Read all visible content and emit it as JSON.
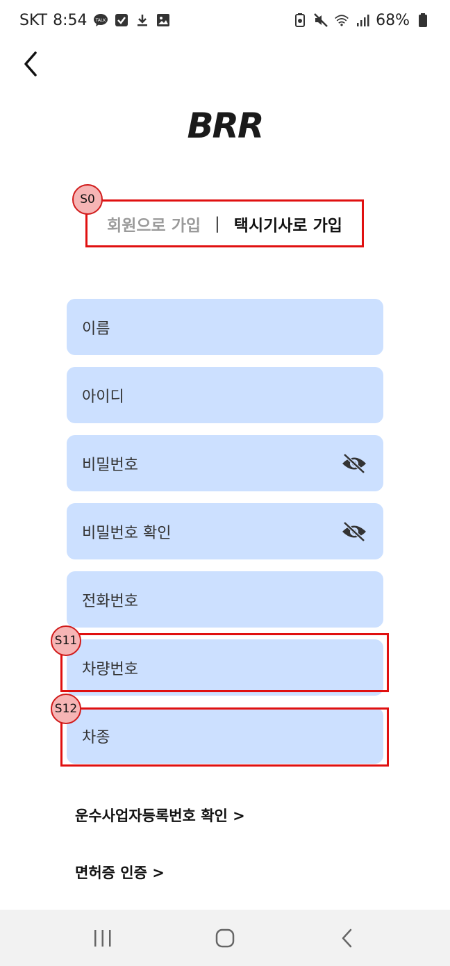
{
  "status_bar": {
    "carrier": "SKT",
    "time": "8:54",
    "battery": "68%",
    "left_icons": [
      "talk-icon",
      "checkbox-icon",
      "download-icon",
      "image-icon"
    ],
    "right_icons": [
      "battery-saver-icon",
      "mute-icon",
      "wifi-icon",
      "signal-icon",
      "battery-icon"
    ]
  },
  "header": {
    "logo": "BRR"
  },
  "tabs": {
    "member": "회원으로 가입",
    "separator": "|",
    "driver": "택시기사로 가입",
    "active": "driver"
  },
  "form": {
    "name": "이름",
    "id": "아이디",
    "password": "비밀번호",
    "password_confirm": "비밀번호 확인",
    "phone": "전화번호",
    "car_number": "차량번호",
    "car_model": "차종"
  },
  "links": {
    "business_registration": "운수사업자등록번호 확인 >",
    "license_verify": "면허증 인증 >"
  },
  "annotations": {
    "s0": "S0",
    "s11": "S11",
    "s12": "S12",
    "color": "#e01010"
  },
  "colors": {
    "field_bg": "#cce0ff",
    "tab_inactive": "#9a9a9a"
  }
}
